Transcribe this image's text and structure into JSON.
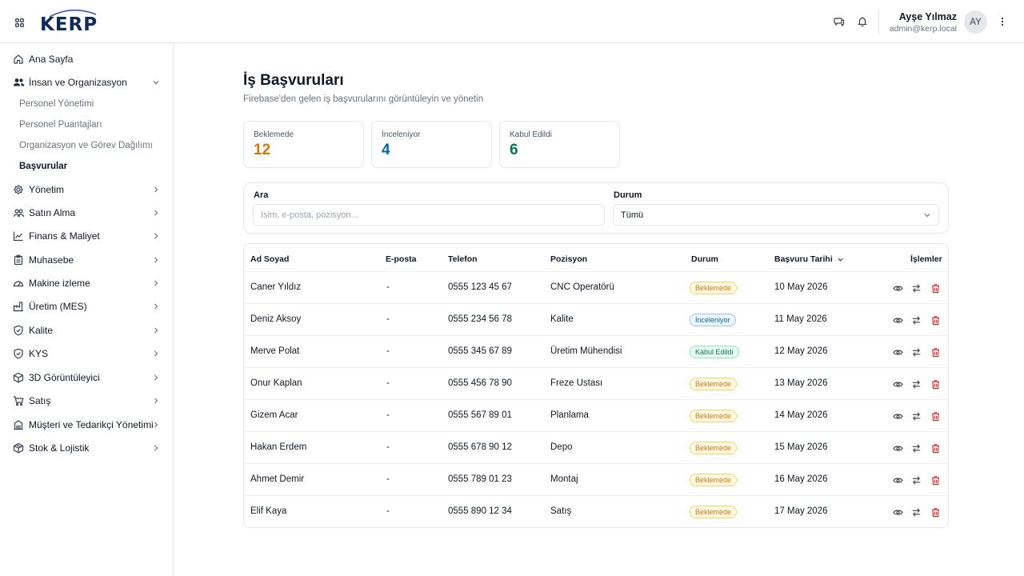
{
  "colors": {
    "pending": "#d97706",
    "reviewing": "#0369a1",
    "accepted": "#047857",
    "delete": "#dc2626",
    "logo": "#0f2a5a"
  },
  "header": {
    "logo_text": "KERP",
    "user_name": "Ayşe Yılmaz",
    "user_email": "admin@kerp.local",
    "avatar_initials": "AY",
    "icons": [
      "grid-icon",
      "chat-icon",
      "bell-icon",
      "more-vertical-icon"
    ]
  },
  "sidebar": {
    "items": [
      {
        "label": "Ana Sayfa",
        "icon": "home-icon"
      },
      {
        "label": "İnsan ve Organizasyon",
        "icon": "users-icon",
        "expanded": true,
        "children": [
          "Personel Yönetimi",
          "Personel Puantajları",
          "Organizasyon ve Görev Dağılımı",
          "Başvurular"
        ],
        "active_child": "Başvurular"
      },
      {
        "label": "Yönetim",
        "icon": "gear-icon"
      },
      {
        "label": "Satın Alma",
        "icon": "handshake-icon"
      },
      {
        "label": "Finans & Maliyet",
        "icon": "chart-line-icon"
      },
      {
        "label": "Muhasebe",
        "icon": "clipboard-icon"
      },
      {
        "label": "Makine izleme",
        "icon": "gauge-icon"
      },
      {
        "label": "Üretim (MES)",
        "icon": "factory-icon"
      },
      {
        "label": "Kalite",
        "icon": "shield-check-icon"
      },
      {
        "label": "KYS",
        "icon": "shield-icon"
      },
      {
        "label": "3D Görüntüleyici",
        "icon": "cube-icon"
      },
      {
        "label": "Satış",
        "icon": "cart-icon"
      },
      {
        "label": "Müşteri ve Tedarikçi Yönetimi",
        "icon": "building-icon"
      },
      {
        "label": "Stok & Lojistik",
        "icon": "package-icon"
      }
    ]
  },
  "page": {
    "title": "İş Başvuruları",
    "subtitle": "Firebase'den gelen iş başvurularını görüntüleyin ve yönetin"
  },
  "stats": [
    {
      "label": "Beklemede",
      "value": "12",
      "status": "pending"
    },
    {
      "label": "İnceleniyor",
      "value": "4",
      "status": "reviewing"
    },
    {
      "label": "Kabul Edildi",
      "value": "6",
      "status": "accepted"
    }
  ],
  "filters": {
    "search_label": "Ara",
    "search_placeholder": "İsim, e-posta, pozisyon...",
    "status_label": "Durum",
    "status_value": "Tümü"
  },
  "table": {
    "columns": [
      "Ad Soyad",
      "E-posta",
      "Telefon",
      "Pozisyon",
      "Durum",
      "Başvuru Tarihi",
      "İşlemler"
    ],
    "rows": [
      {
        "name": "Caner Yıldız",
        "email": "-",
        "phone": "0555 123 45 67",
        "position": "CNC Operatörü",
        "status": "Beklemede",
        "status_key": "pending",
        "date": "10 May 2026"
      },
      {
        "name": "Deniz Aksoy",
        "email": "-",
        "phone": "0555 234 56 78",
        "position": "Kalite",
        "status": "İnceleniyor",
        "status_key": "reviewing",
        "date": "11 May 2026"
      },
      {
        "name": "Merve Polat",
        "email": "-",
        "phone": "0555 345 67 89",
        "position": "Üretim Mühendisi",
        "status": "Kabul Edildi",
        "status_key": "accepted",
        "date": "12 May 2026"
      },
      {
        "name": "Onur Kaplan",
        "email": "-",
        "phone": "0555 456 78 90",
        "position": "Freze Ustası",
        "status": "Beklemede",
        "status_key": "pending",
        "date": "13 May 2026"
      },
      {
        "name": "Gizem Acar",
        "email": "-",
        "phone": "0555 567 89 01",
        "position": "Planlama",
        "status": "Beklemede",
        "status_key": "pending",
        "date": "14 May 2026"
      },
      {
        "name": "Hakan Erdem",
        "email": "-",
        "phone": "0555 678 90 12",
        "position": "Depo",
        "status": "Beklemede",
        "status_key": "pending",
        "date": "15 May 2026"
      },
      {
        "name": "Ahmet Demir",
        "email": "-",
        "phone": "0555 789 01 23",
        "position": "Montaj",
        "status": "Beklemede",
        "status_key": "pending",
        "date": "16 May 2026"
      },
      {
        "name": "Elif Kaya",
        "email": "-",
        "phone": "0555 890 12 34",
        "position": "Satış",
        "status": "Beklemede",
        "status_key": "pending",
        "date": "17 May 2026"
      }
    ]
  }
}
